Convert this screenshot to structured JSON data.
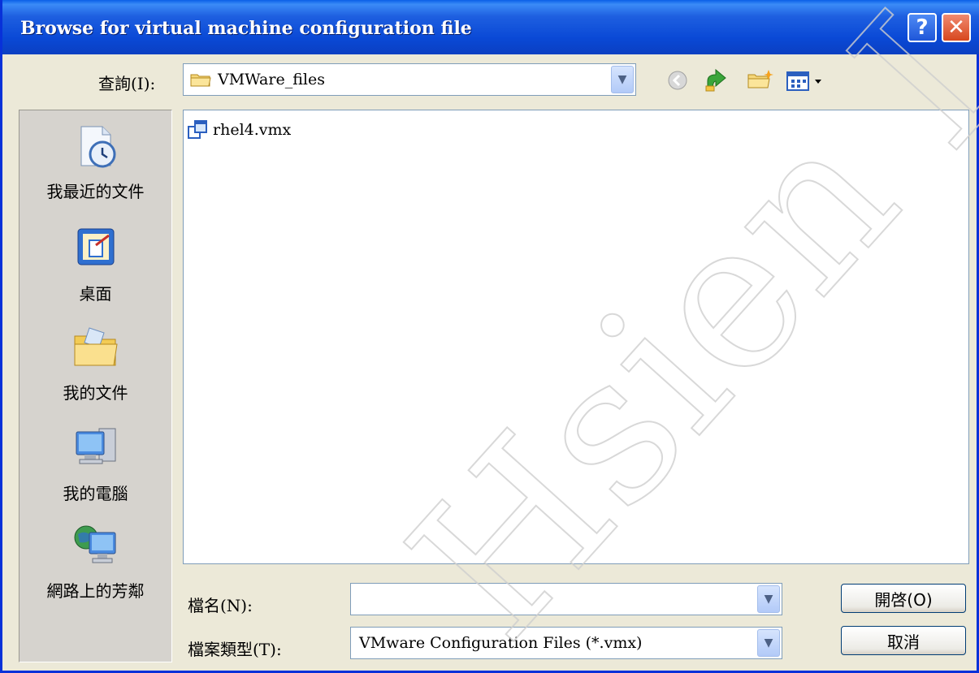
{
  "window": {
    "title": "Browse for virtual machine configuration file"
  },
  "titlebar": {
    "help_label": "?",
    "close_label": "✕"
  },
  "lookin": {
    "label": "查詢(I):",
    "value": "VMWare_files"
  },
  "toolbar": {
    "icons": [
      "back-icon",
      "up-folder-icon",
      "new-folder-icon",
      "view-menu-icon"
    ]
  },
  "places": [
    {
      "label": "我最近的文件",
      "icon": "recent-documents-icon"
    },
    {
      "label": "桌面",
      "icon": "desktop-icon"
    },
    {
      "label": "我的文件",
      "icon": "my-documents-icon"
    },
    {
      "label": "我的電腦",
      "icon": "my-computer-icon"
    },
    {
      "label": "網路上的芳鄰",
      "icon": "network-places-icon"
    }
  ],
  "files": [
    {
      "name": "rhel4.vmx",
      "icon": "vmx-file-icon"
    }
  ],
  "filename": {
    "label": "檔名(N):",
    "value": ""
  },
  "filetype": {
    "label": "檔案類型(T):",
    "value": "VMware Configuration Files (*.vmx)"
  },
  "buttons": {
    "open": "開啓(O)",
    "cancel": "取消"
  },
  "watermark": {
    "text": "Hsien Lee"
  }
}
